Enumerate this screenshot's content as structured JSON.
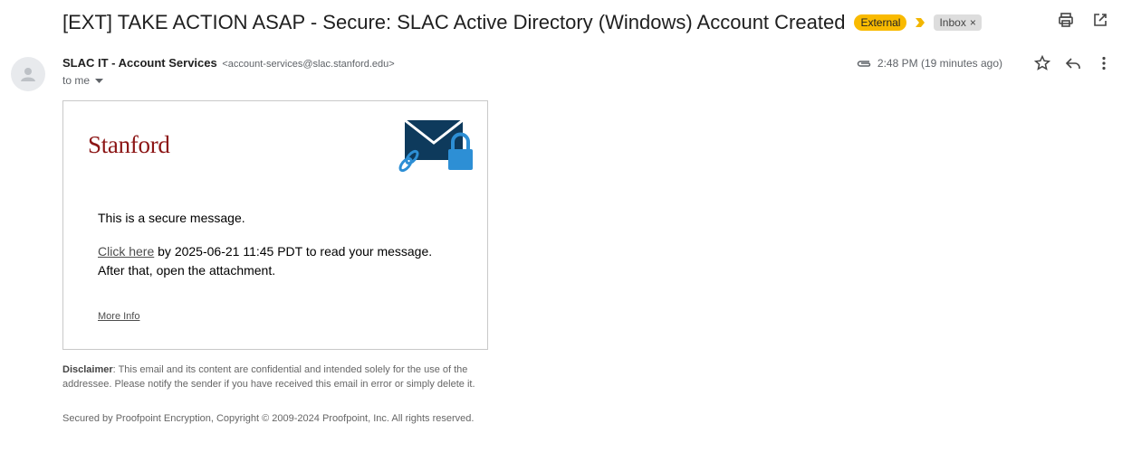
{
  "subject": "[EXT] TAKE ACTION ASAP - Secure: SLAC Active Directory (Windows) Account Created",
  "labels": {
    "external": "External",
    "inbox": "Inbox",
    "inbox_close": "×"
  },
  "sender": {
    "name": "SLAC IT - Account Services",
    "email": "<account-services@slac.stanford.edu>",
    "to": "to me"
  },
  "meta": {
    "timestamp": "2:48 PM (19 minutes ago)"
  },
  "body": {
    "logo_text": "Stanford",
    "secure_line": "This is a secure message.",
    "link_text": "Click here",
    "link_suffix": " by 2025-06-21 11:45 PDT to read your message.",
    "line2": "After that, open the attachment.",
    "more_info": "More Info"
  },
  "footer": {
    "disclaimer_label": "Disclaimer",
    "disclaimer_text": ":  This email and its content are confidential and intended solely for the use of the addressee. Please notify the sender if you have received this email in error or simply delete it.",
    "secured": "Secured by Proofpoint Encryption, Copyright © 2009-2024 Proofpoint, Inc. All rights reserved."
  },
  "icons": {
    "print": "print-icon",
    "open_new": "open-in-new-window-icon",
    "attachment": "attachment-icon",
    "star": "star-icon",
    "reply": "reply-icon",
    "more": "more-vert-icon"
  },
  "colors": {
    "external_label": "#f9ba00",
    "stanford_red": "#8c1515",
    "envelope": "#0e3a5c",
    "lock": "#2d8fd5"
  }
}
